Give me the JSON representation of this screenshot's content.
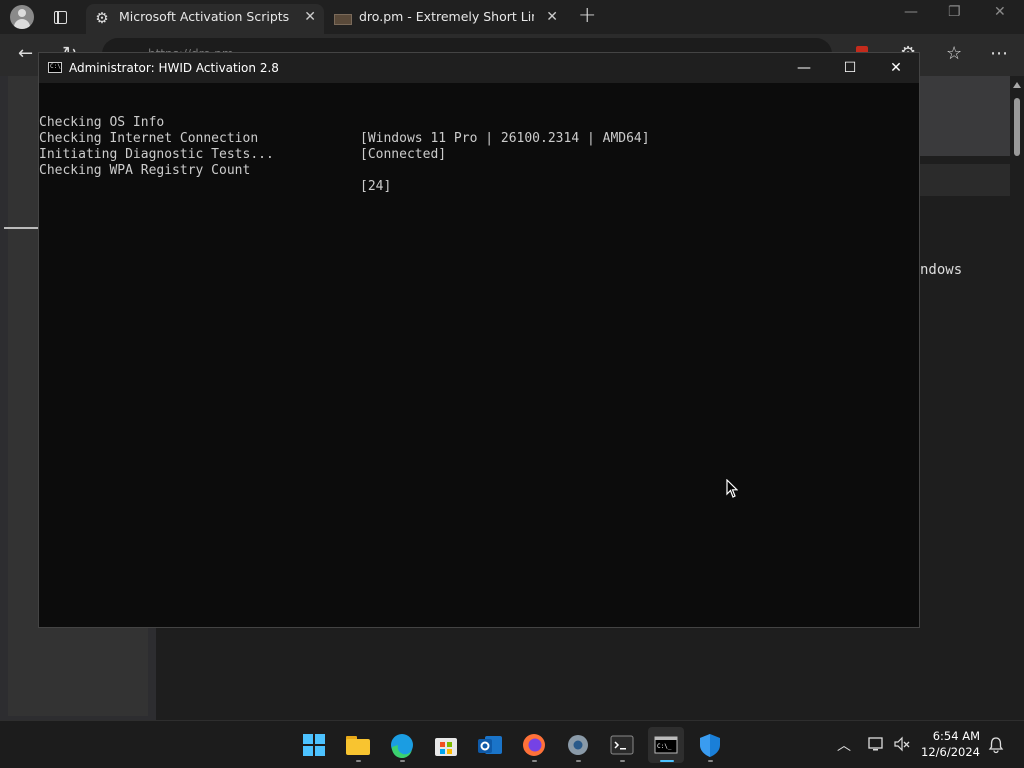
{
  "browser": {
    "tabs": [
      {
        "title": "Microsoft Activation Scripts (MAS",
        "icon": "gear-icon"
      },
      {
        "title": "dro.pm - Extremely Short Links",
        "icon": "page-icon"
      }
    ],
    "address": "https://dro.pm",
    "background_text": "ndows"
  },
  "console": {
    "title": "Administrator:  HWID Activation 2.8",
    "lines": [
      {
        "label": "Checking OS Info",
        "value": "[Windows 11 Pro | 26100.2314 | AMD64]"
      },
      {
        "label": "Checking Internet Connection",
        "value": "[Connected]"
      },
      {
        "label": "Initiating Diagnostic Tests...",
        "value": ""
      },
      {
        "label": "Checking WPA Registry Count",
        "value": "[24]"
      }
    ]
  },
  "taskbar": {
    "apps": [
      "start-icon",
      "file-explorer-icon",
      "edge-icon",
      "store-icon",
      "outlook-icon",
      "firefox-icon",
      "settings-icon",
      "terminal-icon",
      "cmd-icon",
      "defender-icon"
    ],
    "active_app": "cmd-icon",
    "time": "6:54 AM",
    "date": "12/6/2024"
  },
  "colors": {
    "console_bg": "#0c0c0c",
    "console_text": "#cccccc",
    "accent": "#4cc2ff"
  }
}
